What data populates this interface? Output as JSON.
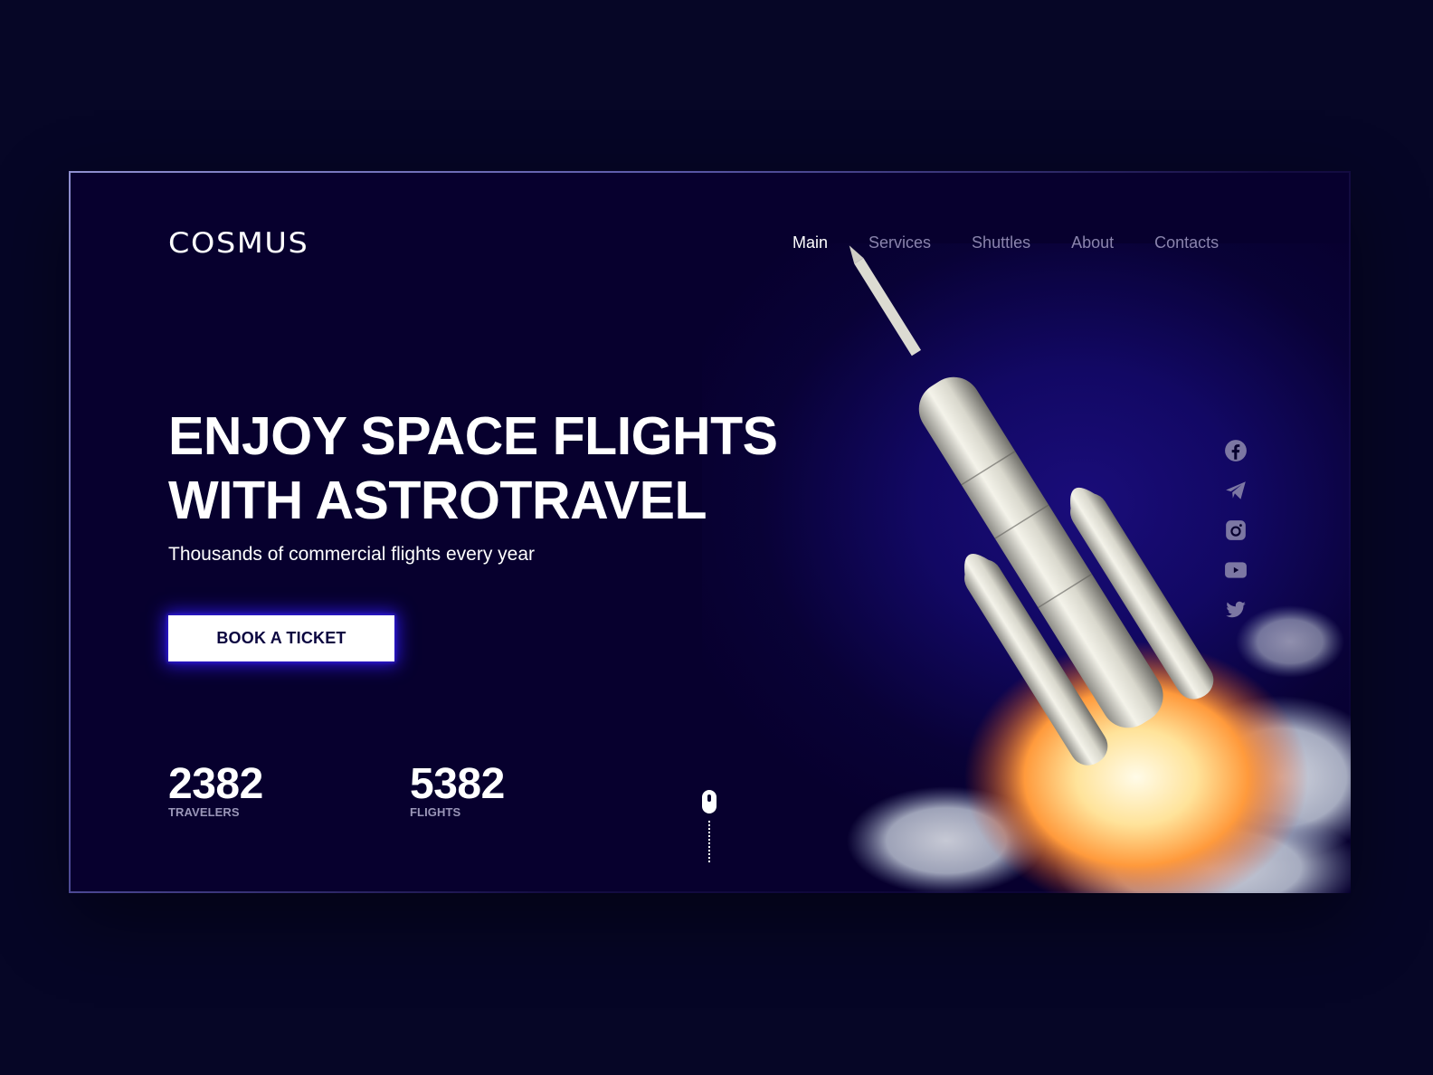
{
  "brand": {
    "logo": "COSMUS"
  },
  "nav": {
    "items": [
      {
        "label": "Main",
        "active": true
      },
      {
        "label": "Services",
        "active": false
      },
      {
        "label": "Shuttles",
        "active": false
      },
      {
        "label": "About",
        "active": false
      },
      {
        "label": "Contacts",
        "active": false
      }
    ]
  },
  "hero": {
    "title_line1": "ENJOY SPACE FLIGHTS",
    "title_line2": "WITH ASTROTRAVEL",
    "subtitle": "Thousands of commercial flights every year",
    "cta_label": "BOOK A TICKET"
  },
  "stats": [
    {
      "value": "2382",
      "label": "TRAVELERS"
    },
    {
      "value": "5382",
      "label": "FLIGHTS"
    }
  ],
  "social": [
    {
      "icon": "facebook-icon"
    },
    {
      "icon": "telegram-icon"
    },
    {
      "icon": "instagram-icon"
    },
    {
      "icon": "youtube-icon"
    },
    {
      "icon": "twitter-icon"
    }
  ],
  "scroll_indicator": {
    "icon": "mouse-icon"
  },
  "colors": {
    "page_bg": "#060626",
    "frame_bg": "#07002e",
    "accent_glow": "#2a14d6",
    "nav_inactive": "#8a84ad",
    "social_icon": "#7c77a3",
    "cta_text": "#0b0640"
  }
}
